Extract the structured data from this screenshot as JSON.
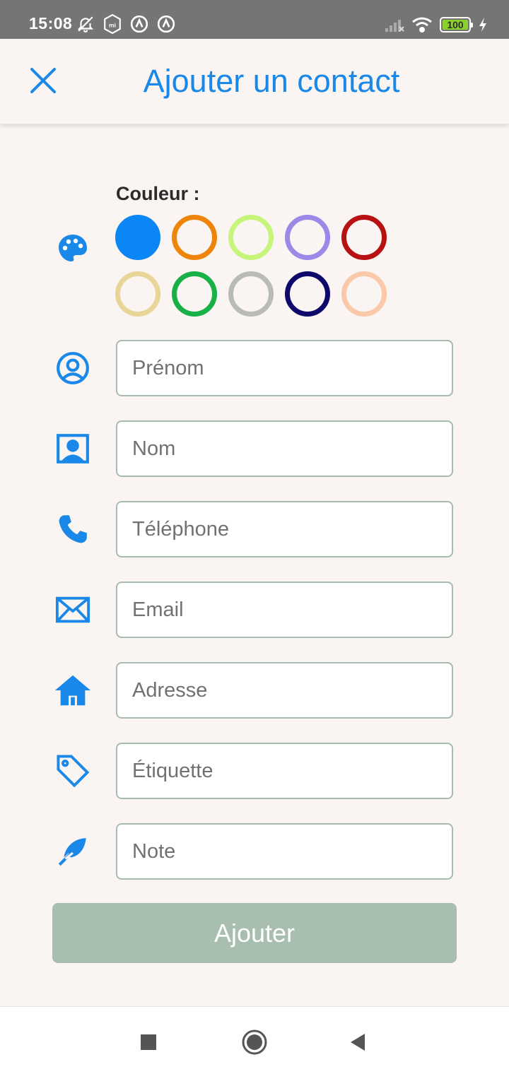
{
  "status_bar": {
    "time": "15:08",
    "battery": "100",
    "left_icons": [
      "bell-off-icon",
      "mi-icon",
      "app-icon",
      "app-icon"
    ],
    "right_icons": [
      "signal-icon",
      "wifi-icon",
      "battery-icon",
      "charging-icon"
    ]
  },
  "header": {
    "title": "Ajouter un contact",
    "close_icon": "close-icon"
  },
  "color_picker": {
    "label": "Couleur :",
    "icon": "palette-icon",
    "selected_index": 0,
    "options": [
      "#0a86f5",
      "#ef8508",
      "#c6f57b",
      "#9d87e7",
      "#b81111",
      "#e8d698",
      "#18b148",
      "#b9bcb6",
      "#0d0a6b",
      "#fbc9a9"
    ]
  },
  "fields": [
    {
      "placeholder": "Prénom",
      "value": "",
      "icon": "person-circle-icon"
    },
    {
      "placeholder": "Nom",
      "value": "",
      "icon": "contact-card-icon"
    },
    {
      "placeholder": "Téléphone",
      "value": "",
      "icon": "phone-icon"
    },
    {
      "placeholder": "Email",
      "value": "",
      "icon": "envelope-icon"
    },
    {
      "placeholder": "Adresse",
      "value": "",
      "icon": "home-icon"
    },
    {
      "placeholder": "Étiquette",
      "value": "",
      "icon": "tag-icon"
    },
    {
      "placeholder": "Note",
      "value": "",
      "icon": "feather-icon"
    }
  ],
  "submit_label": "Ajouter",
  "colors": {
    "accent": "#1a88e8",
    "background": "#faf5f2",
    "field_border": "#a7bcae",
    "button_disabled": "#a8bfb0"
  },
  "nav": {
    "buttons": [
      "recents-icon",
      "home-icon",
      "back-icon"
    ]
  }
}
